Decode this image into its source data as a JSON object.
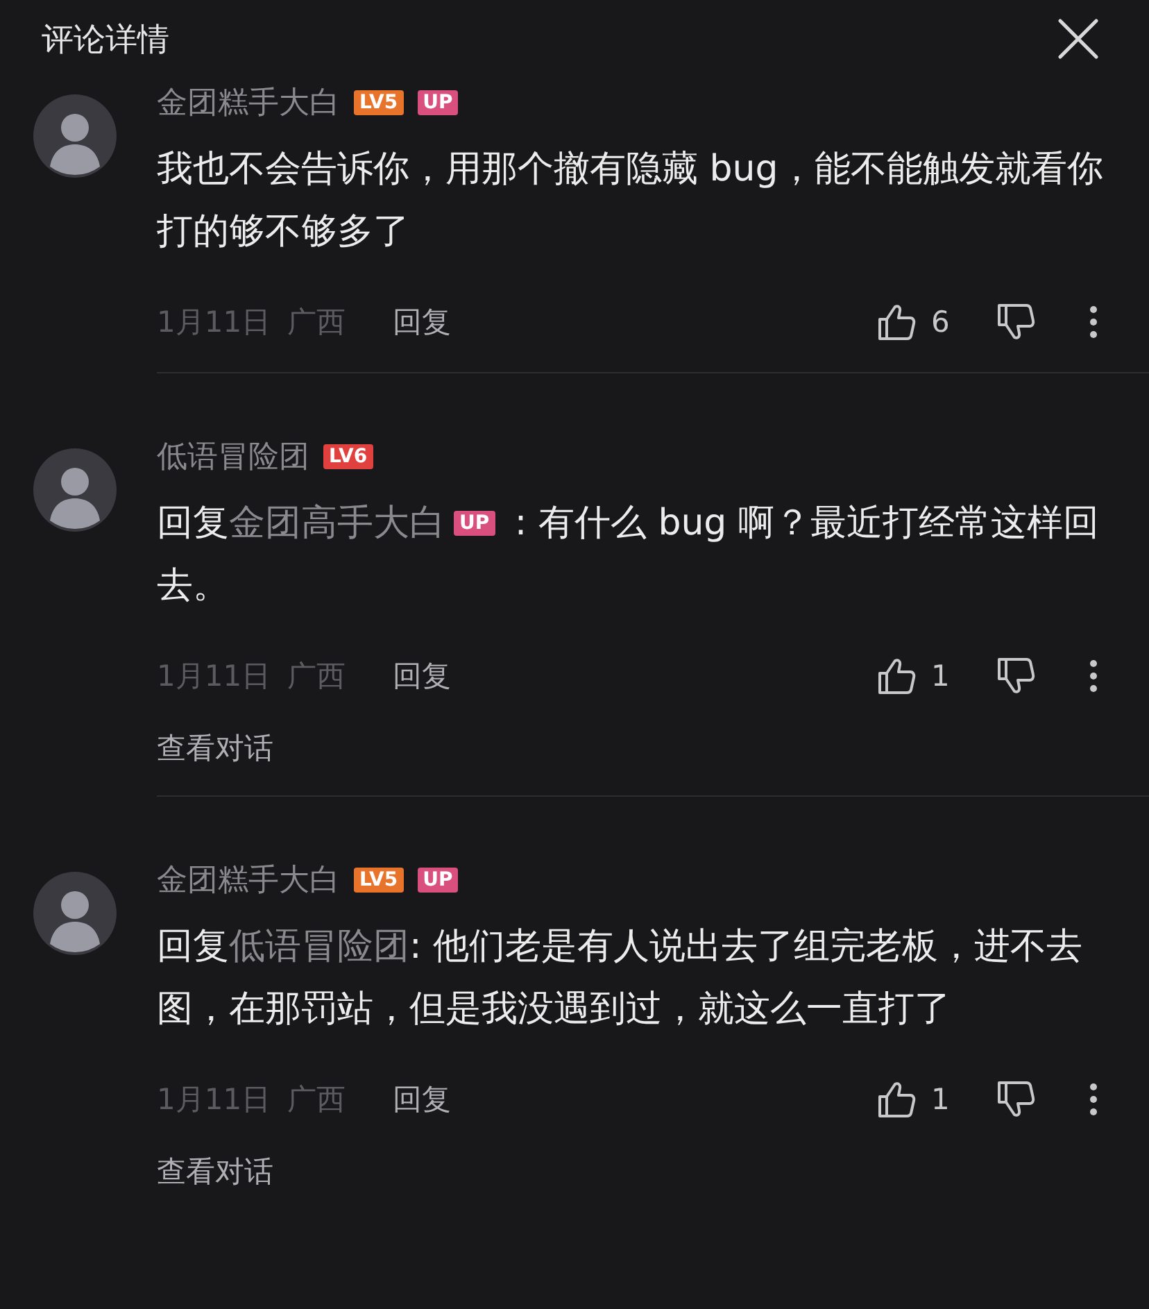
{
  "header": {
    "title": "评论详情"
  },
  "comments": [
    {
      "name": "金团糕手大白",
      "level": {
        "label": "LV5",
        "color": "#e8742c"
      },
      "up": {
        "label": "UP"
      },
      "text": "我也不会告诉你，用那个撤有隐藏 bug，能不能触发就看你打的够不够多了",
      "date": "1月11日",
      "location": "广西",
      "reply": "回复",
      "likes": "6"
    },
    {
      "name": "低语冒险团",
      "level": {
        "label": "LV6",
        "color": "#e0413f"
      },
      "reply_prefix": "回复",
      "reply_to": {
        "name": "金团高手大白",
        "up": "UP"
      },
      "text": " : 有什么 bug 啊？最近打经常这样回去。",
      "date": "1月11日",
      "location": "广西",
      "reply": "回复",
      "likes": "1",
      "view": "查看对话"
    },
    {
      "name": "金团糕手大白",
      "level": {
        "label": "LV5",
        "color": "#e8742c"
      },
      "up": {
        "label": "UP"
      },
      "reply_prefix": "回复",
      "reply_to": {
        "name": "低语冒险团"
      },
      "text": ": 他们老是有人说出去了组完老板，进不去图，在那罚站，但是我没遇到过，就这么一直打了",
      "date": "1月11日",
      "location": "广西",
      "reply": "回复",
      "likes": "1",
      "view": "查看对话"
    }
  ]
}
